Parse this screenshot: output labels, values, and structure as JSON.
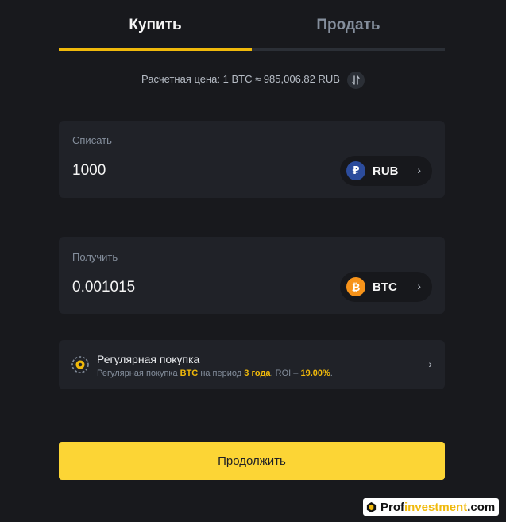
{
  "tabs": {
    "buy": "Купить",
    "sell": "Продать"
  },
  "rate": {
    "text": "Расчетная цена: 1 BTC ≈ 985,006.82 RUB",
    "swap_icon": "swap-vertical-icon"
  },
  "spend": {
    "label": "Списать",
    "value": "1000",
    "currency": "RUB",
    "currency_symbol": "₽",
    "currency_color": "#2c4c9c"
  },
  "receive": {
    "label": "Получить",
    "value": "0.001015",
    "currency": "BTC",
    "currency_symbol": "₿",
    "currency_color": "#f7931a"
  },
  "recurring": {
    "title": "Регулярная покупка",
    "sub_prefix": "Регулярная покупка",
    "sub_coin": "BTC",
    "sub_period_text": "на период",
    "sub_period": "3 года",
    "sub_roi_text": ", ROI –",
    "sub_roi": "19.00%",
    "sub_end": "."
  },
  "continue_label": "Продолжить",
  "watermark": {
    "part1": "Prof",
    "part2": "investment",
    "part3": ".com"
  },
  "colors": {
    "accent": "#f0b90b",
    "button": "#fcd535",
    "background": "#18191d",
    "card": "#202228"
  }
}
